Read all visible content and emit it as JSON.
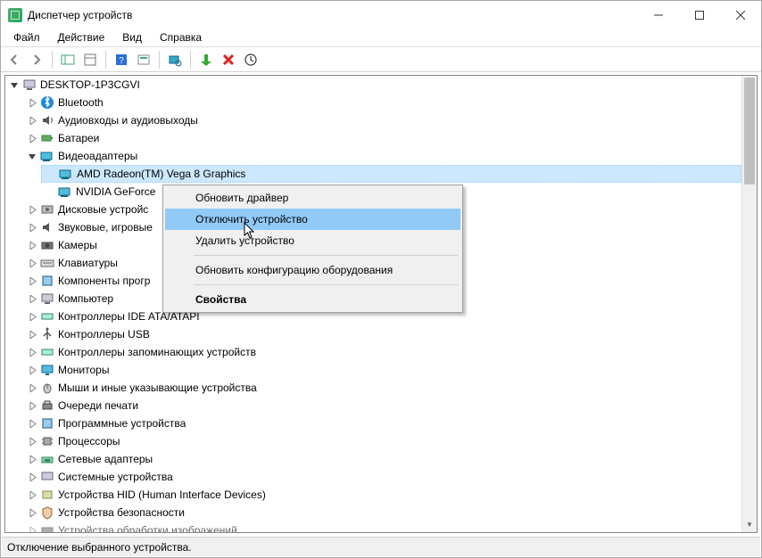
{
  "window": {
    "title": "Диспетчер устройств"
  },
  "menu": {
    "file": "Файл",
    "action": "Действие",
    "view": "Вид",
    "help": "Справка"
  },
  "tree": {
    "root": "DESKTOP-1P3CGVI",
    "bluetooth": "Bluetooth",
    "audio_io": "Аудиовходы и аудиовыходы",
    "batteries": "Батареи",
    "display_adapters": "Видеоадаптеры",
    "gpu_amd": "AMD Radeon(TM) Vega 8 Graphics",
    "gpu_nvidia": "NVIDIA GeForce",
    "disk_drives": "Дисковые устройс",
    "sound_game": "Звуковые, игровые",
    "cameras": "Камеры",
    "keyboards": "Клавиатуры",
    "software_components": "Компоненты прогр",
    "computer": "Компьютер",
    "ide_ata": "Контроллеры IDE ATA/ATAPI",
    "usb_ctrl": "Контроллеры USB",
    "storage_ctrl": "Контроллеры запоминающих устройств",
    "monitors": "Мониторы",
    "mice": "Мыши и иные указывающие устройства",
    "print_queues": "Очереди печати",
    "software_devices": "Программные устройства",
    "processors": "Процессоры",
    "network": "Сетевые адаптеры",
    "system_devices": "Системные устройства",
    "hid": "Устройства HID (Human Interface Devices)",
    "security_devices": "Устройства безопасности",
    "imaging": "Устройства обработки изображений"
  },
  "context_menu": {
    "update_driver": "Обновить драйвер",
    "disable_device": "Отключить устройство",
    "uninstall_device": "Удалить устройство",
    "scan_hardware": "Обновить конфигурацию оборудования",
    "properties": "Свойства"
  },
  "statusbar": {
    "text": "Отключение выбранного устройства."
  }
}
